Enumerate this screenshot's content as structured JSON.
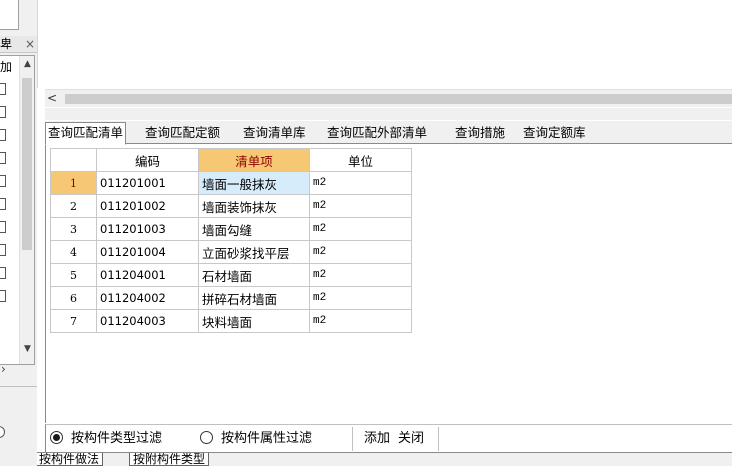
{
  "left_panel": {
    "title_fragment": "卑",
    "close_glyph": "×",
    "list_header_fragment": "加",
    "scroll_up_glyph": "▲",
    "scroll_down_glyph": "▼",
    "expand_glyph": "›"
  },
  "main": {
    "scroll_left_glyph": "<",
    "tabs": [
      {
        "label": "查询匹配清单",
        "active": true
      },
      {
        "label": "查询匹配定额",
        "active": false
      },
      {
        "label": "查询清单库",
        "active": false
      },
      {
        "label": "查询匹配外部清单",
        "active": false
      },
      {
        "label": "查询措施",
        "active": false
      },
      {
        "label": "查询定额库",
        "active": false
      }
    ],
    "grid": {
      "headers": [
        "",
        "编码",
        "清单项",
        "单位"
      ],
      "rows": [
        {
          "num": "1",
          "code": "011201001",
          "name": "墙面一般抹灰",
          "unit": "m2"
        },
        {
          "num": "2",
          "code": "011201002",
          "name": "墙面装饰抹灰",
          "unit": "m2"
        },
        {
          "num": "3",
          "code": "011201003",
          "name": "墙面勾缝",
          "unit": "m2"
        },
        {
          "num": "4",
          "code": "011201004",
          "name": "立面砂浆找平层",
          "unit": "m2"
        },
        {
          "num": "5",
          "code": "011204001",
          "name": "石材墙面",
          "unit": "m2"
        },
        {
          "num": "6",
          "code": "011204002",
          "name": "拼碎石材墙面",
          "unit": "m2"
        },
        {
          "num": "7",
          "code": "011204003",
          "name": "块料墙面",
          "unit": "m2"
        }
      ]
    },
    "filters": {
      "by_type": "按构件类型过滤",
      "by_attr": "按构件属性过滤",
      "selected": "by_type"
    },
    "actions": {
      "add": "添加",
      "close": "关闭"
    },
    "bottom_tabs": [
      "按构件做法",
      "按附构件类型"
    ]
  },
  "colors": {
    "selected_header_bg": "#f7c873",
    "selected_header_text": "#8b0000",
    "selected_cell_bg": "#d7ecfa"
  }
}
